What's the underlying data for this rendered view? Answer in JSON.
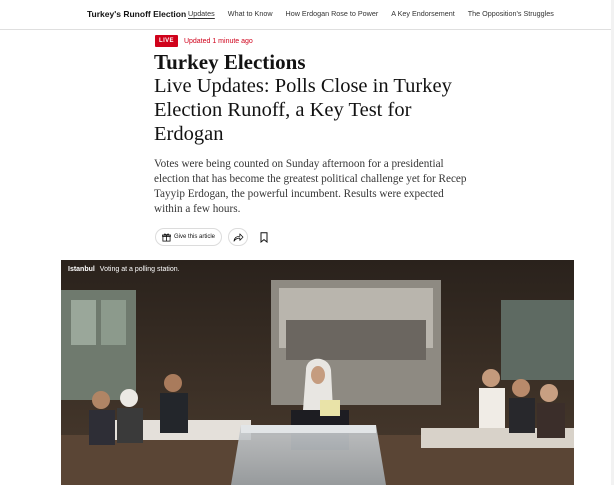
{
  "nav": {
    "section_title": "Turkey's Runoff Election",
    "links": [
      {
        "label": "Updates",
        "active": true
      },
      {
        "label": "What to Know",
        "active": false
      },
      {
        "label": "How Erdogan Rose to Power",
        "active": false
      },
      {
        "label": "A Key Endorsement",
        "active": false
      },
      {
        "label": "The Opposition's Struggles",
        "active": false
      }
    ]
  },
  "article": {
    "live_label": "LIVE",
    "updated": "Updated 1 minute ago",
    "kicker": "Turkey Elections",
    "headline": "Live Updates: Polls Close in Turkey Election Runoff, a Key Test for Erdogan",
    "summary": "Votes were being counted on Sunday afternoon for a presidential election that has become the greatest political challenge yet for Recep Tayyip Erdogan, the powerful incumbent. Results were expected within a few hours."
  },
  "tools": {
    "gift_label": "Give this article",
    "share_icon": "share-arrow-icon",
    "save_icon": "bookmark-icon",
    "gift_icon": "gift-icon"
  },
  "photo": {
    "location": "Istanbul",
    "caption": "Voting at a polling station."
  },
  "colors": {
    "live_red": "#d0021b",
    "text": "#121212",
    "summary_text": "#363636"
  }
}
